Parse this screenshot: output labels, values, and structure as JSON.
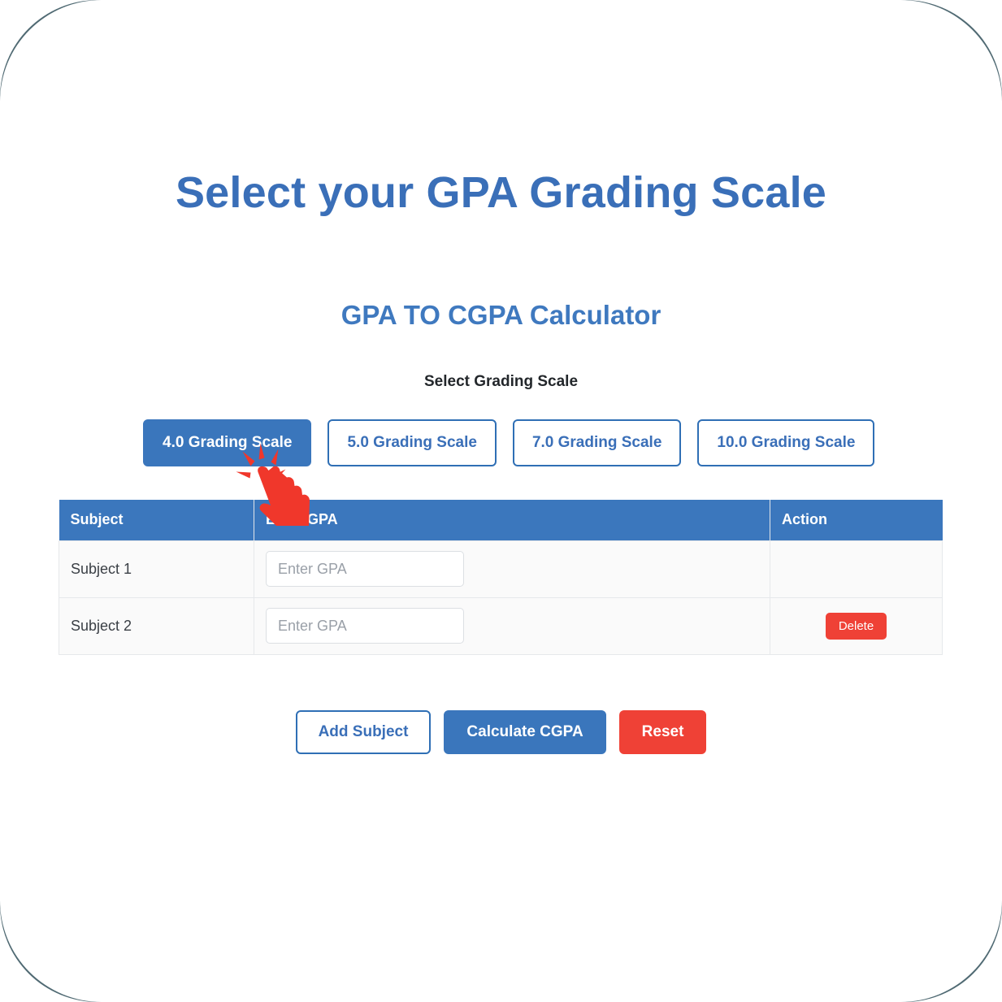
{
  "page": {
    "title": "Select your GPA Grading Scale",
    "subtitle": "GPA TO CGPA Calculator",
    "scale_label": "Select Grading Scale"
  },
  "colors": {
    "primary_blue": "#3a76bc",
    "title_blue": "#3a6fb8",
    "table_header_blue": "#3b77bd",
    "danger_red": "#ef4136",
    "outline_border": "#2f6fb5",
    "row_background": "#fafafa",
    "backdrop": "#506a73"
  },
  "scale_buttons": [
    {
      "label": "4.0 Grading Scale",
      "active": true
    },
    {
      "label": "5.0 Grading Scale",
      "active": false
    },
    {
      "label": "7.0 Grading Scale",
      "active": false
    },
    {
      "label": "10.0 Grading Scale",
      "active": false
    }
  ],
  "table": {
    "headers": [
      "Subject",
      "Enter GPA",
      "Action"
    ],
    "rows": [
      {
        "subject": "Subject 1",
        "gpa_value": "",
        "gpa_placeholder": "Enter GPA",
        "action_label": ""
      },
      {
        "subject": "Subject 2",
        "gpa_value": "",
        "gpa_placeholder": "Enter GPA",
        "action_label": "Delete"
      }
    ]
  },
  "actions": {
    "add_subject": "Add Subject",
    "calculate": "Calculate CGPA",
    "reset": "Reset"
  },
  "cursor": {
    "icon": "pointing-hand-click-icon",
    "color": "#f0372b"
  }
}
